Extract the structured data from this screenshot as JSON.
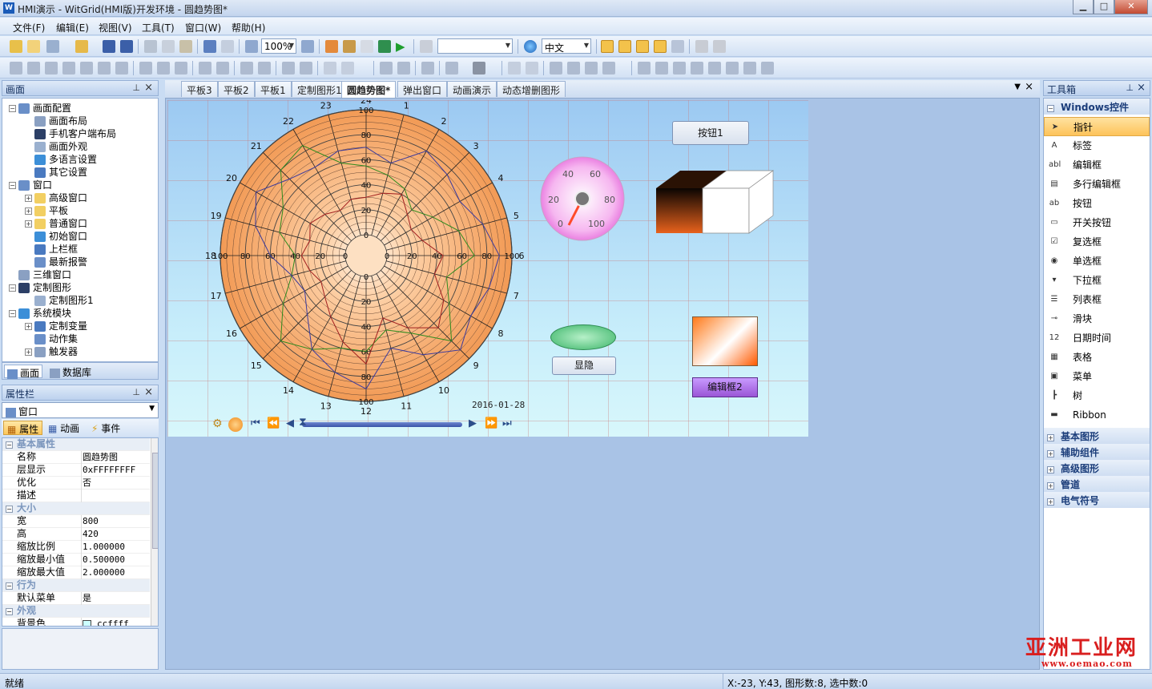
{
  "window": {
    "title": "HMI演示 - WitGrid(HMI版)开发环境 - 圆趋势图*",
    "min": "▁",
    "max": "□",
    "close": "✕",
    "icon_text": "W"
  },
  "menu": [
    "文件(F)",
    "编辑(E)",
    "视图(V)",
    "工具(T)",
    "窗口(W)",
    "帮助(H)"
  ],
  "toolbar": {
    "zoom": "100%",
    "language": "中文",
    "combo_empty": ""
  },
  "left_panel": {
    "title": "画面",
    "tree": [
      {
        "label": "画面配置",
        "level": 0,
        "exp": "−"
      },
      {
        "label": "画面布局",
        "level": 1
      },
      {
        "label": "手机客户端布局",
        "level": 1
      },
      {
        "label": "画面外观",
        "level": 1
      },
      {
        "label": "多语言设置",
        "level": 1
      },
      {
        "label": "其它设置",
        "level": 1
      },
      {
        "label": "窗口",
        "level": 0,
        "exp": "−"
      },
      {
        "label": "高级窗口",
        "level": 1,
        "exp": "+"
      },
      {
        "label": "平板",
        "level": 1,
        "exp": "+"
      },
      {
        "label": "普通窗口",
        "level": 1,
        "exp": "+"
      },
      {
        "label": "初始窗口",
        "level": 1
      },
      {
        "label": "上栏框",
        "level": 1
      },
      {
        "label": "最新报警",
        "level": 1
      },
      {
        "label": "三维窗口",
        "level": 0
      },
      {
        "label": "定制图形",
        "level": 0,
        "exp": "−"
      },
      {
        "label": "定制图形1",
        "level": 1
      },
      {
        "label": "系统模块",
        "level": 0,
        "exp": "−"
      },
      {
        "label": "定制变量",
        "level": 1,
        "exp": "+"
      },
      {
        "label": "动作集",
        "level": 1
      },
      {
        "label": "触发器",
        "level": 1,
        "exp": "+"
      }
    ],
    "bottom_tabs": [
      "画面",
      "数据库"
    ]
  },
  "props": {
    "title": "属性栏",
    "selected": "窗口",
    "tabs": [
      "属性",
      "动画",
      "事件"
    ],
    "rows": [
      {
        "cat": "基本属性"
      },
      {
        "k": "名称",
        "v": "圆趋势图"
      },
      {
        "k": "层显示",
        "v": "0xFFFFFFFF"
      },
      {
        "k": "优化",
        "v": "否"
      },
      {
        "k": "描述",
        "v": ""
      },
      {
        "cat": "大小"
      },
      {
        "k": "宽",
        "v": "800"
      },
      {
        "k": "高",
        "v": "420"
      },
      {
        "k": "缩放比例",
        "v": "1.000000"
      },
      {
        "k": "缩放最小值",
        "v": "0.500000"
      },
      {
        "k": "缩放最大值",
        "v": "2.000000"
      },
      {
        "cat": "行为"
      },
      {
        "k": "默认菜单",
        "v": "是"
      },
      {
        "cat": "外观"
      },
      {
        "k": "背景色",
        "v": "ccffff"
      }
    ]
  },
  "doc_tabs": [
    "平板3",
    "平板2",
    "平板1",
    "定制图形1",
    "圆趋势图*",
    "弹出窗口",
    "动画演示",
    "动态增删图形"
  ],
  "active_tab": "圆趋势图*",
  "canvas": {
    "button1": "按钮1",
    "toggle_btn": "显隐",
    "editbox2": "编辑框2",
    "date": "2016-01-28",
    "gauge_ticks": [
      "0",
      "20",
      "40",
      "60",
      "80",
      "100"
    ]
  },
  "chart_data": {
    "type": "polar-trend",
    "hour_labels": [
      "24",
      "1",
      "2",
      "3",
      "4",
      "5",
      "6",
      "7",
      "8",
      "9",
      "10",
      "11",
      "12",
      "13",
      "14",
      "15",
      "16",
      "17",
      "18",
      "19",
      "20",
      "21",
      "22",
      "23"
    ],
    "radial_labels_top": [
      "100",
      "80",
      "60",
      "40",
      "20",
      "0"
    ],
    "radial_labels_bottom": [
      "0",
      "20",
      "40",
      "60",
      "80",
      "100"
    ],
    "radial_labels_right": [
      "0",
      "20",
      "40",
      "60",
      "80",
      "100"
    ],
    "radial_labels_left": [
      "100",
      "80",
      "60",
      "40",
      "20",
      "0"
    ],
    "series": [
      {
        "color": "#2e8b1e",
        "values": [
          55,
          50,
          45,
          35,
          45,
          60,
          70,
          50,
          60,
          80,
          55,
          45,
          60,
          60,
          70,
          80,
          60,
          45,
          40,
          55,
          60,
          80,
          85,
          60
        ]
      },
      {
        "color": "#3a3a9e",
        "values": [
          70,
          60,
          80,
          75,
          70,
          80,
          90,
          85,
          80,
          90,
          75,
          60,
          90,
          80,
          70,
          50,
          40,
          45,
          60,
          75,
          85,
          70,
          65,
          70
        ]
      },
      {
        "color": "#a01e1e",
        "values": [
          30,
          35,
          40,
          30,
          25,
          30,
          45,
          40,
          55,
          65,
          50,
          35,
          70,
          55,
          40,
          30,
          25,
          30,
          35,
          30,
          35,
          30,
          25,
          30
        ]
      }
    ],
    "rmax": 100
  },
  "toolbox": {
    "title": "工具箱",
    "group_open": "Windows控件",
    "items": [
      {
        "label": "指针",
        "icon": "pointer-icon",
        "glyph": "➤"
      },
      {
        "label": "标签",
        "icon": "label-icon",
        "glyph": "A"
      },
      {
        "label": "编辑框",
        "icon": "textbox-icon",
        "glyph": "abl"
      },
      {
        "label": "多行编辑框",
        "icon": "multiline-icon",
        "glyph": "▤"
      },
      {
        "label": "按钮",
        "icon": "button-icon",
        "glyph": "ab"
      },
      {
        "label": "开关按钮",
        "icon": "toggle-icon",
        "glyph": "▭"
      },
      {
        "label": "复选框",
        "icon": "checkbox-icon",
        "glyph": "☑"
      },
      {
        "label": "单选框",
        "icon": "radio-icon",
        "glyph": "◉"
      },
      {
        "label": "下拉框",
        "icon": "combobox-icon",
        "glyph": "▾"
      },
      {
        "label": "列表框",
        "icon": "listbox-icon",
        "glyph": "☰"
      },
      {
        "label": "滑块",
        "icon": "slider-icon",
        "glyph": "⊸"
      },
      {
        "label": "日期时间",
        "icon": "datetime-icon",
        "glyph": "12"
      },
      {
        "label": "表格",
        "icon": "table-icon",
        "glyph": "▦"
      },
      {
        "label": "菜单",
        "icon": "menu-icon",
        "glyph": "▣"
      },
      {
        "label": "树",
        "icon": "tree-icon",
        "glyph": "┣"
      },
      {
        "label": "Ribbon",
        "icon": "ribbon-icon",
        "glyph": "▬"
      }
    ],
    "groups_closed": [
      "基本图形",
      "辅助组件",
      "高级图形",
      "管道",
      "电气符号"
    ]
  },
  "status": {
    "left": "就绪",
    "right": "X:-23, Y:43, 图形数:8, 选中数:0"
  },
  "watermark": {
    "main": "亚洲工业网",
    "url": "www.oemao.com"
  }
}
